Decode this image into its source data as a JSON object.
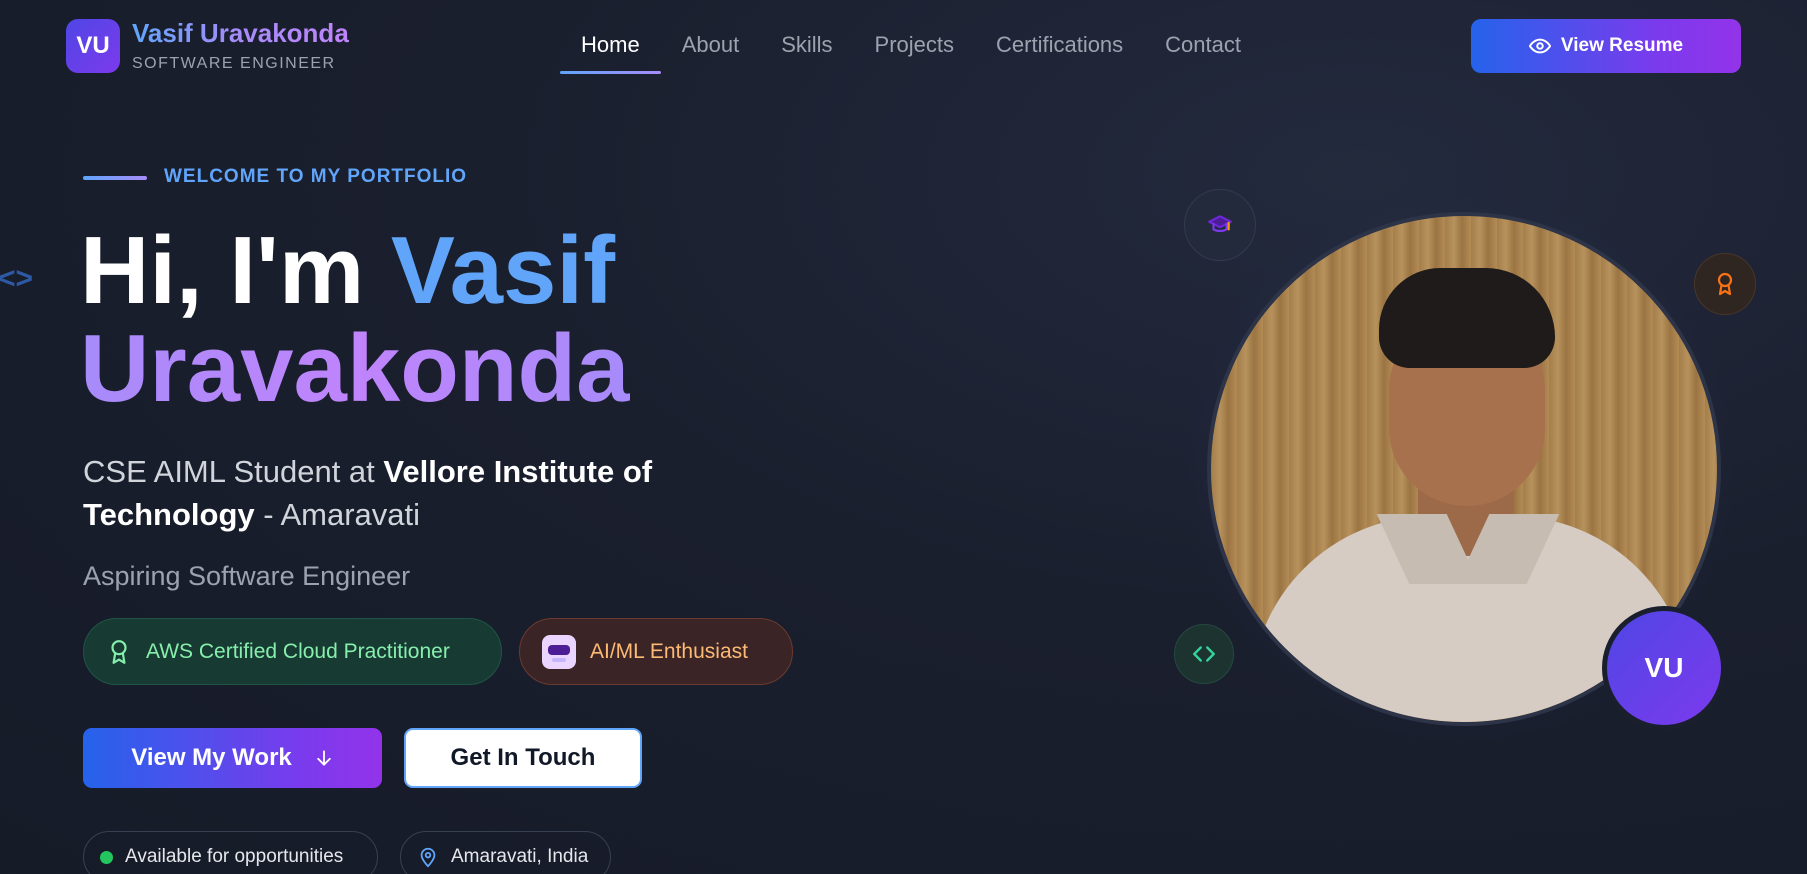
{
  "header": {
    "logo_initials": "VU",
    "brand_name": "Vasif Uravakonda",
    "brand_subtitle": "SOFTWARE ENGINEER",
    "nav": [
      {
        "label": "Home",
        "active": true
      },
      {
        "label": "About",
        "active": false
      },
      {
        "label": "Skills",
        "active": false
      },
      {
        "label": "Projects",
        "active": false
      },
      {
        "label": "Certifications",
        "active": false
      },
      {
        "label": "Contact",
        "active": false
      }
    ],
    "resume_button": {
      "label": "View Resume",
      "icon": "eye-icon"
    }
  },
  "hero": {
    "welcome": "WELCOME TO MY PORTFOLIO",
    "title_prefix": "Hi, I'm ",
    "title_first_name": "Vasif",
    "title_last_name": "Uravakonda",
    "subtitle_part1": "CSE AIML Student at ",
    "subtitle_institute": "Vellore Institute of Technology",
    "subtitle_part2": " - Amaravati",
    "tagline": "Aspiring Software Engineer",
    "badges": [
      {
        "label": "AWS Certified Cloud Practitioner",
        "icon": "award-icon",
        "color": "#86efac"
      },
      {
        "label": "AI/ML Enthusiast",
        "icon": "robot-icon",
        "color": "#fdba74"
      }
    ],
    "primary_button": {
      "label": "View My Work",
      "icon": "arrow-down-icon"
    },
    "secondary_button": {
      "label": "Get In Touch"
    },
    "status_chips": [
      {
        "label": "Available for opportunities",
        "icon": "status-dot"
      },
      {
        "label": "Amaravati, India",
        "icon": "map-pin-icon"
      }
    ]
  },
  "profile": {
    "badge_initials": "VU",
    "floating_icons": [
      "graduation-cap-icon",
      "award-icon",
      "code-icon"
    ]
  },
  "colors": {
    "background": "#1a1f2e",
    "accent_blue": "#60a5fa",
    "accent_purple": "#a78bfa",
    "button_gradient_start": "#2563eb",
    "button_gradient_end": "#9333ea"
  }
}
